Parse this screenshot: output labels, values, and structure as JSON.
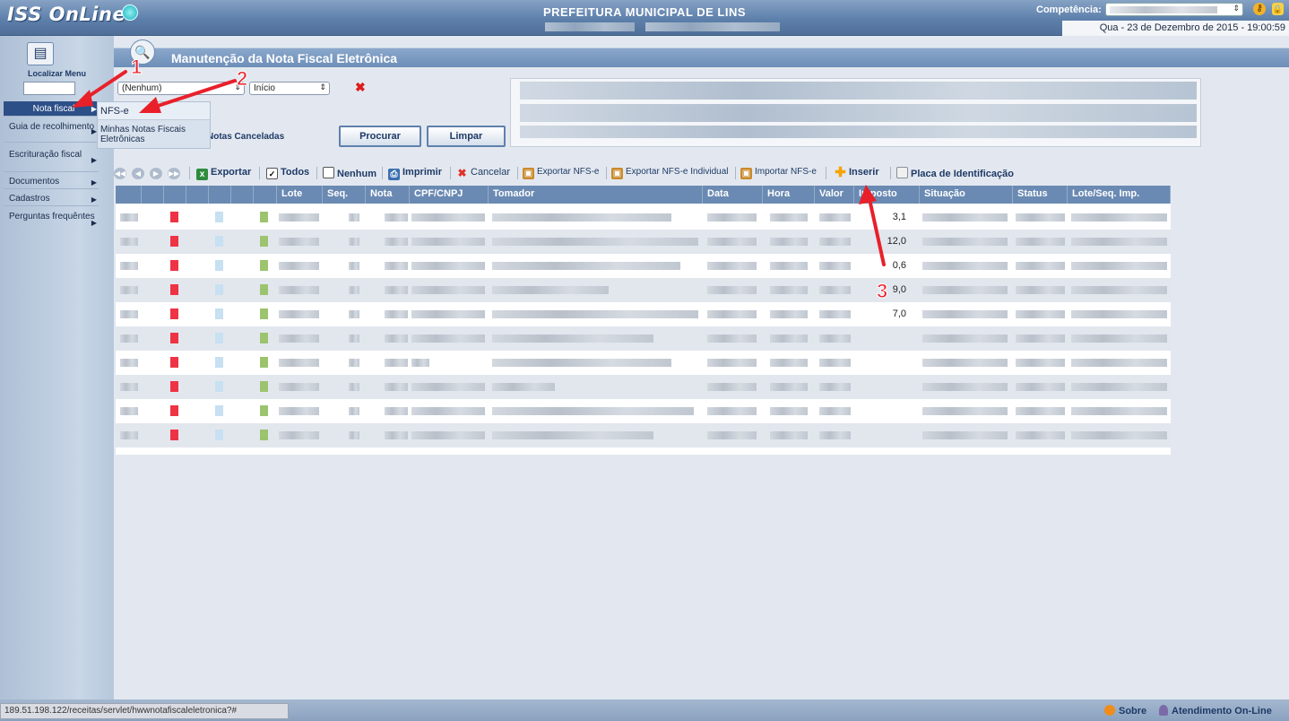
{
  "header": {
    "logo": "ISS OnLine",
    "municipality": "PREFEITURA MUNICIPAL DE LINS",
    "competencia_label": "Competência:",
    "date": "Qua  -  23 de Dezembro de 2015  -  19:00:59"
  },
  "sidebar": {
    "search_label": "Localizar Menu",
    "items": [
      {
        "label": "Nota fiscal"
      },
      {
        "label": "Guia de recolhimento"
      },
      {
        "label": "Escrituração fiscal"
      },
      {
        "label": "Documentos"
      },
      {
        "label": "Cadastros"
      },
      {
        "label": "Perguntas frequêntes"
      }
    ],
    "submenu": [
      {
        "label": "NFS-e"
      },
      {
        "label": "Minhas Notas Fiscais Eletrônicas"
      }
    ]
  },
  "main": {
    "title": "Manutenção da Nota Fiscal Eletrônica",
    "filter": {
      "select1_value": "(Nenhum)",
      "select2_value": "Início",
      "notas_canceladas_label": "Notas Canceladas",
      "procurar_label": "Procurar",
      "limpar_label": "Limpar"
    },
    "toolbar": {
      "exportar": "Exportar",
      "todos": "Todos",
      "nenhum": "Nenhum",
      "imprimir": "Imprimir",
      "cancelar": "Cancelar",
      "exportar_nfse": "Exportar NFS-e",
      "exportar_nfse_individual": "Exportar NFS-e Individual",
      "importar_nfse": "Importar NFS-e",
      "inserir": "Inserir",
      "placa": "Placa de Identificação"
    },
    "table": {
      "columns": [
        "Lote",
        "Seq.",
        "Nota",
        "CPF/CNPJ",
        "Tomador",
        "Data",
        "Hora",
        "Valor",
        "Imposto",
        "Situação",
        "Status",
        "Lote/Seq. Imp."
      ],
      "imposto_values": [
        "3,1",
        "12,0",
        "0,6",
        "9,0",
        "7,0"
      ]
    }
  },
  "annotations": [
    "1",
    "2",
    "3"
  ],
  "statusbar": {
    "url": "189.51.198.122/receitas/servlet/hwwnotafiscaleletronica?#",
    "sobre": "Sobre",
    "atendimento": "Atendimento On-Line"
  },
  "colors": {
    "header_blue": "#5d80ab",
    "accent_dark": "#2d4f88",
    "table_header": "#6a8ab3",
    "arrow_red": "#e8202a"
  }
}
